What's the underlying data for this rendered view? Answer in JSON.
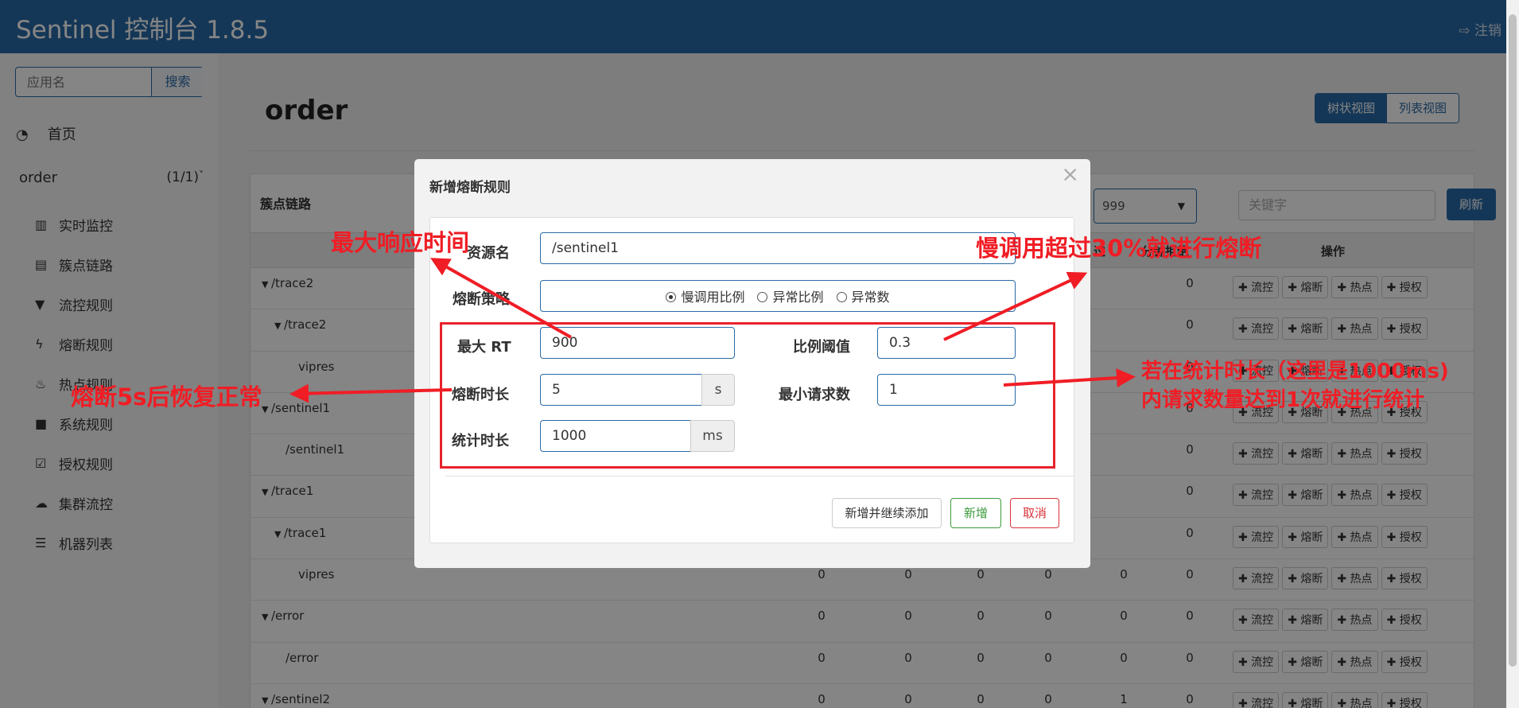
{
  "header": {
    "title": "Sentinel 控制台 1.8.5",
    "logout": "注销"
  },
  "sidebar": {
    "search": {
      "placeholder": "应用名",
      "button": "搜索"
    },
    "home": "首页",
    "app": {
      "name": "order",
      "count": "(1/1)"
    },
    "items": [
      {
        "label": "实时监控",
        "icon": "bar-chart-icon"
      },
      {
        "label": "簇点链路",
        "icon": "list-icon"
      },
      {
        "label": "流控规则",
        "icon": "filter-icon"
      },
      {
        "label": "熔断规则",
        "icon": "bolt-icon"
      },
      {
        "label": "热点规则",
        "icon": "fire-icon"
      },
      {
        "label": "系统规则",
        "icon": "lock-icon"
      },
      {
        "label": "授权规则",
        "icon": "check-icon"
      },
      {
        "label": "集群流控",
        "icon": "cloud-icon"
      },
      {
        "label": "机器列表",
        "icon": "table-list-icon"
      }
    ]
  },
  "main": {
    "title": "order",
    "view_toggle": {
      "tree": "树状视图",
      "list": "列表视图"
    },
    "panel": {
      "title": "簇点链路",
      "select_value": "999",
      "keyword_placeholder": "关键字",
      "refresh": "刷新",
      "headers": {
        "partial_a": "过",
        "partial_b": "分钟拒绝",
        "ops": "操作"
      },
      "op_labels": [
        "✚ 流控",
        "✚ 熔断",
        "✚ 热点",
        "✚ 授权"
      ],
      "rows": [
        {
          "name": "/trace2",
          "caret": true,
          "indent": 0,
          "values": [
            "",
            "",
            "",
            "",
            "",
            "0"
          ]
        },
        {
          "name": "/trace2",
          "caret": true,
          "indent": 1,
          "values": [
            "",
            "",
            "",
            "",
            "",
            "0"
          ]
        },
        {
          "name": "vipres",
          "caret": false,
          "indent": 2,
          "values": [
            "",
            "",
            "",
            "",
            "",
            "0"
          ]
        },
        {
          "name": "/sentinel1",
          "caret": true,
          "indent": 0,
          "values": [
            "",
            "",
            "",
            "",
            "",
            "0"
          ]
        },
        {
          "name": "/sentinel1",
          "caret": false,
          "indent": 1,
          "values": [
            "",
            "",
            "",
            "",
            "",
            "0"
          ]
        },
        {
          "name": "/trace1",
          "caret": true,
          "indent": 0,
          "values": [
            "",
            "",
            "",
            "",
            "",
            "0"
          ]
        },
        {
          "name": "/trace1",
          "caret": true,
          "indent": 1,
          "values": [
            "",
            "",
            "",
            "",
            "",
            "0"
          ]
        },
        {
          "name": "vipres",
          "caret": false,
          "indent": 2,
          "values": [
            "0",
            "0",
            "0",
            "0",
            "0",
            "0"
          ]
        },
        {
          "name": "/error",
          "caret": true,
          "indent": 0,
          "values": [
            "0",
            "0",
            "0",
            "0",
            "0",
            "0"
          ]
        },
        {
          "name": "/error",
          "caret": false,
          "indent": 1,
          "values": [
            "0",
            "0",
            "0",
            "0",
            "0",
            "0"
          ]
        },
        {
          "name": "/sentinel2",
          "caret": true,
          "indent": 0,
          "values": [
            "0",
            "0",
            "0",
            "0",
            "1",
            "0"
          ]
        }
      ]
    }
  },
  "modal": {
    "title": "新增熔断规则",
    "close": "×",
    "resource_label": "资源名",
    "resource_value": "/sentinel1",
    "strategy_label": "熔断策略",
    "strategies": [
      {
        "label": "慢调用比例",
        "checked": true
      },
      {
        "label": "异常比例",
        "checked": false
      },
      {
        "label": "异常数",
        "checked": false
      }
    ],
    "max_rt_label": "最大 RT",
    "max_rt_value": "900",
    "ratio_label": "比例阈值",
    "ratio_value": "0.3",
    "duration_label": "熔断时长",
    "duration_value": "5",
    "duration_unit": "s",
    "min_req_label": "最小请求数",
    "min_req_value": "1",
    "stat_label": "统计时长",
    "stat_value": "1000",
    "stat_unit": "ms",
    "btn_add_continue": "新增并继续添加",
    "btn_add": "新增",
    "btn_cancel": "取消"
  },
  "annotations": {
    "max_rt": "最大响应时间",
    "slow_ratio": "慢调用超过30%就进行熔断",
    "recover": "熔断5s后恢复正常",
    "stat_line1": "若在统计时长（这里是1000ms)",
    "stat_line2": "内请求数量达到1次就进行统计"
  },
  "colors": {
    "primary": "#2a6aa7",
    "annotation": "#f01d25",
    "success": "#3c9a3c",
    "danger": "#d9343b"
  }
}
